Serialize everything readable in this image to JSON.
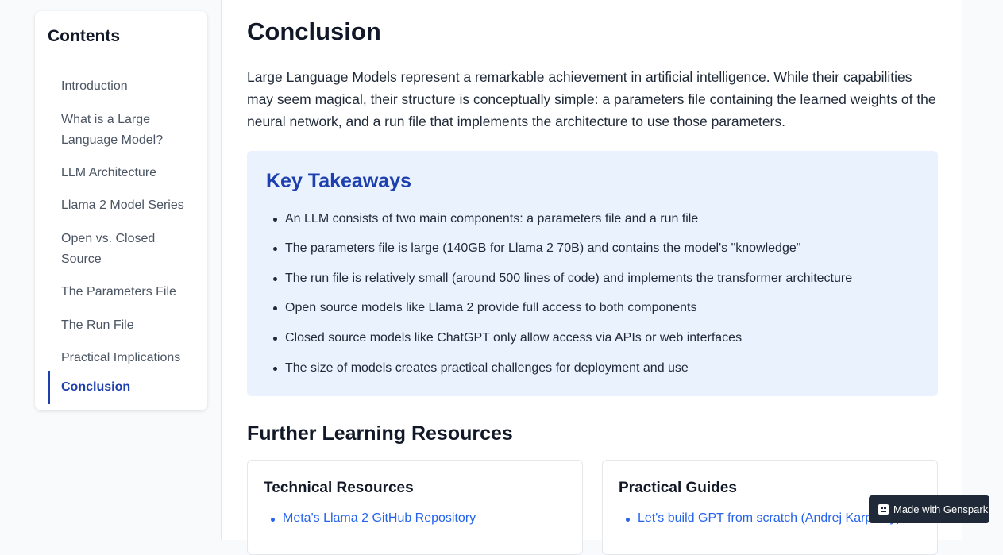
{
  "toc": {
    "title": "Contents",
    "items": [
      {
        "label": "Introduction"
      },
      {
        "label": "What is a Large Language Model?"
      },
      {
        "label": "LLM Architecture"
      },
      {
        "label": "Llama 2 Model Series"
      },
      {
        "label": "Open vs. Closed Source"
      },
      {
        "label": "The Parameters File"
      },
      {
        "label": "The Run File"
      },
      {
        "label": "Practical Implications"
      },
      {
        "label": "Conclusion"
      }
    ],
    "active": "Conclusion"
  },
  "main": {
    "heading": "Conclusion",
    "intro": "Large Language Models represent a remarkable achievement in artificial intelligence. While their capabilities may seem magical, their structure is conceptually simple: a parameters file containing the learned weights of the neural network, and a run file that implements the architecture to use those parameters.",
    "takeaways": {
      "title": "Key Takeaways",
      "items": [
        "An LLM consists of two main components: a parameters file and a run file",
        "The parameters file is large (140GB for Llama 2 70B) and contains the model's \"knowledge\"",
        "The run file is relatively small (around 500 lines of code) and implements the transformer architecture",
        "Open source models like Llama 2 provide full access to both components",
        "Closed source models like ChatGPT only allow access via APIs or web interfaces",
        "The size of models creates practical challenges for deployment and use"
      ]
    },
    "resources": {
      "heading": "Further Learning Resources",
      "cards": [
        {
          "title": "Technical Resources",
          "link": "Meta's Llama 2 GitHub Repository"
        },
        {
          "title": "Practical Guides",
          "link": "Let's build GPT from scratch (Andrej Karpathy)"
        }
      ]
    }
  },
  "badge": {
    "label": "Made with Genspark",
    "icon": "genspark-icon"
  },
  "colors": {
    "accent": "#1e40af",
    "link": "#2563eb",
    "takeaway_bg": "#eaf2fe",
    "badge_bg": "#1f2937"
  }
}
